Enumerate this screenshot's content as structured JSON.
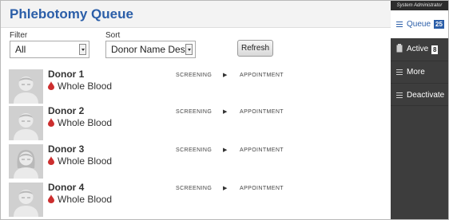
{
  "header": {
    "title": "Phlebotomy Queue"
  },
  "filter": {
    "label": "Filter",
    "value": "All"
  },
  "sort": {
    "label": "Sort",
    "value": "Donor Name Desc"
  },
  "refresh_label": "Refresh",
  "steps": {
    "screening": "SCREENING",
    "appointment": "APPOINTMENT"
  },
  "donors": [
    {
      "name": "Donor 1",
      "product": "Whole Blood",
      "avatar": "male-avatar"
    },
    {
      "name": "Donor 2",
      "product": "Whole Blood",
      "avatar": "male-avatar"
    },
    {
      "name": "Donor 3",
      "product": "Whole Blood",
      "avatar": "female-avatar"
    },
    {
      "name": "Donor 4",
      "product": "Whole Blood",
      "avatar": "male-avatar"
    }
  ],
  "sidebar": {
    "role": "System Administrator",
    "items": [
      {
        "label": "Queue",
        "badge": "25",
        "icon": "menu-icon"
      },
      {
        "label": "Active",
        "badge": "8",
        "icon": "clipboard-icon"
      },
      {
        "label": "More",
        "icon": "menu-icon"
      },
      {
        "label": "Deactivate",
        "icon": "menu-icon"
      }
    ]
  },
  "colors": {
    "accent": "#2b5ea8",
    "sidebar": "#3d3d3d",
    "drop": "#cc2e2e"
  }
}
